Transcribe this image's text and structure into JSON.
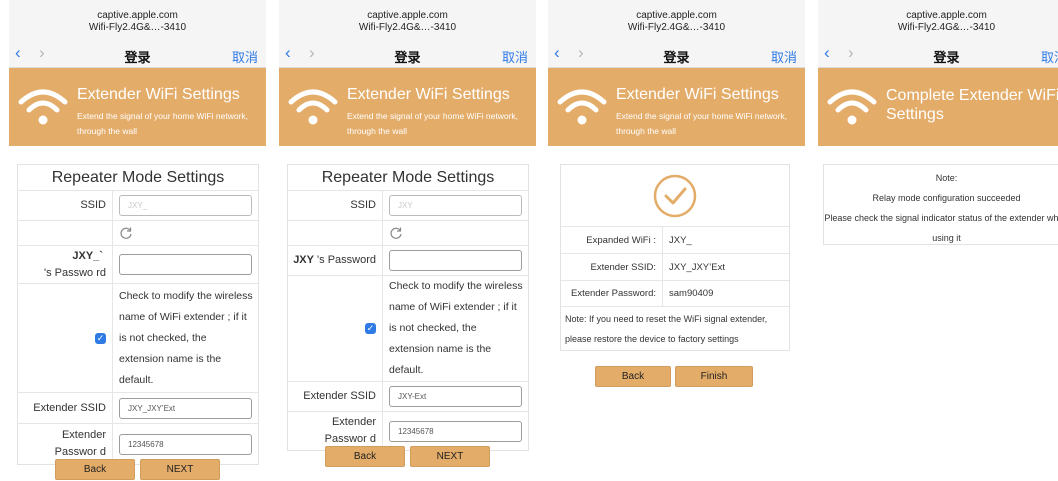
{
  "browser": {
    "host": "captive.apple.com",
    "network": "Wifi-Fly2.4G&…-3410",
    "page_title": "登录",
    "cancel_label": "取消",
    "back_glyph": "‹",
    "forward_glyph": "›"
  },
  "banner": {
    "icon": "wifi-icon",
    "title": "Extender WiFi Settings",
    "subtitle": "Extend the signal of your home WiFi network, through the wall",
    "complete_title": "Complete Extender WiFi Settings"
  },
  "colors": {
    "accent": "#e3ac69",
    "link": "#2f7ae5"
  },
  "form": {
    "heading": "Repeater Mode Settings",
    "ssid_label": "SSID",
    "ssid_placeholder_1": "JXY_",
    "ssid_placeholder_2": "JXY",
    "password_label_1": "'s Passwo rd",
    "password_prefix_1": "JXY_`",
    "password_label_2": "'s Password",
    "password_prefix_2": "JXY",
    "modify_hint_1": "Check to modify the wireless name of WiFi extender ; if it is not checked, the extension name is the default.",
    "modify_hint_2": "Check to modify the wireless name of WiFi extender ; if it is not checked, the extension name is the default.",
    "modify_checked": true,
    "extender_ssid_label": "Extender SSID",
    "extender_ssid_value_1": "JXY_JXY’Ext",
    "extender_ssid_value_2": "JXY-Ext",
    "extender_password_label_1": "Extender Passwor d",
    "extender_password_label_2": "Extender Passwor d",
    "extender_password_value": "12345678",
    "back_label": "Back",
    "next_label": "NEXT"
  },
  "result": {
    "expanded_wifi_label": "Expanded WiFi :",
    "expanded_wifi_value": "JXY_",
    "extender_ssid_label": "Extender SSID:",
    "extender_ssid_value": "JXY_JXY’Ext",
    "extender_password_label": "Extender Password:",
    "extender_password_value": "sam90409",
    "note": "Note: If you need to reset the WiFi signal extender, please restore the device to factory settings",
    "back_label": "Back",
    "finish_label": "Finish"
  },
  "complete": {
    "note_title": "Note:",
    "line1": "Relay mode configuration succeeded",
    "line2": "Please check the signal indicator status of the extender when using it"
  }
}
